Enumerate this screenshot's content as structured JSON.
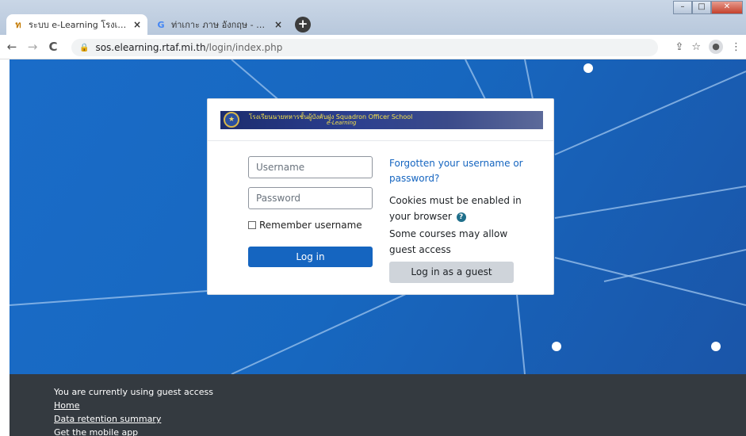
{
  "browser": {
    "tabs": [
      {
        "favicon": "ท",
        "title": "ระบบ e-Learning โรงเรียนนายทหารชั้นผู้บังคับฝูง",
        "close": "×"
      },
      {
        "favicon": "G",
        "title": "ท่าเกาะ ภาษ อังกฤษ - Google Search",
        "close": "×"
      }
    ],
    "new_tab": "+",
    "window_controls": {
      "minimize": "–",
      "maximize": "□",
      "close": "✕"
    },
    "nav": {
      "back": "←",
      "forward": "→",
      "reload": "C"
    },
    "url_host": "sos.elearning.rtaf.mi.th",
    "url_path": "/login/index.php",
    "toolbar_icons": {
      "share": "⇪",
      "bookmark": "☆",
      "profile": "👤",
      "menu": "⋮"
    }
  },
  "banner": {
    "seal": "★",
    "text": "โรงเรียนนายทหารชั้นผู้บังคับฝูง  Squadron Officer School",
    "sub": "e-Learning"
  },
  "login": {
    "username_placeholder": "Username",
    "password_placeholder": "Password",
    "remember_label": "Remember username",
    "login_button": "Log in",
    "forgot_link": "Forgotten your username or password?",
    "cookies_text": "Cookies must be enabled in your browser",
    "help_icon": "?",
    "guest_note": "Some courses may allow guest access",
    "guest_button": "Log in as a guest"
  },
  "footer": {
    "status": "You are currently using guest access",
    "links": [
      "Home",
      "Data retention summary",
      "Get the mobile app"
    ]
  }
}
